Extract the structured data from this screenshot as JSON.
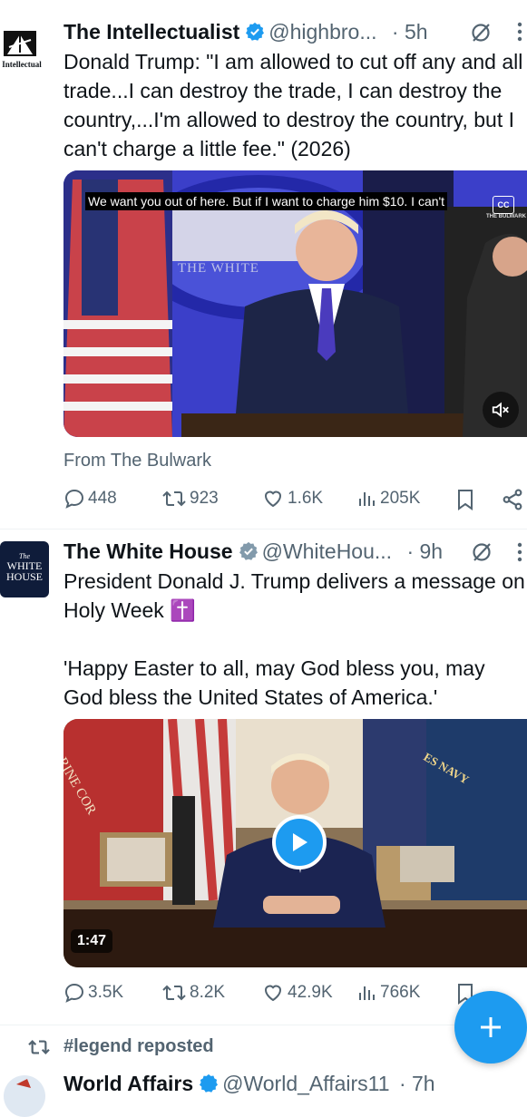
{
  "tweets": [
    {
      "display_name": "The Intellectualist",
      "handle": "@highbro...",
      "time": "· 5h",
      "avatar_text": "e Intellectual",
      "text": "Donald Trump: \"I am allowed to cut off any and all trade...I can destroy the trade, I can destroy the country,...I'm allowed to destroy the country, but I can't charge a little fee.\" (2026)",
      "video_caption": "We want you out of here. But if I want to charge him $10. I can't",
      "cc_label": "CC",
      "watermark": "THE BULWARK",
      "podium_text": "THE WHITE",
      "source": "From The Bulwark",
      "stats": {
        "replies": "448",
        "reposts": "923",
        "likes": "1.6K",
        "views": "205K"
      }
    },
    {
      "display_name": "The White House",
      "handle": "@WhiteHou...",
      "time": "· 9h",
      "avatar_line1": "The",
      "avatar_line2": "WHITE",
      "avatar_line3": "HOUSE",
      "text": "President Donald J. Trump delivers a message on Holy Week ✝️\n\n'Happy Easter to all, may God bless you, may God bless the United States of America.'",
      "duration": "1:47",
      "flag_text_1": "RINE COR",
      "flag_text_2": "ES NAVY",
      "stats": {
        "replies": "3.5K",
        "reposts": "8.2K",
        "likes": "42.9K",
        "views": "766K"
      }
    }
  ],
  "repost_banner": "#legend reposted",
  "next_tweet": {
    "display_name": "World Affairs",
    "handle": "@World_Affairs11",
    "time": "· 7h"
  },
  "colors": {
    "accent": "#1d9bf0",
    "secondary_text": "#536471",
    "divider": "#eff3f4"
  }
}
